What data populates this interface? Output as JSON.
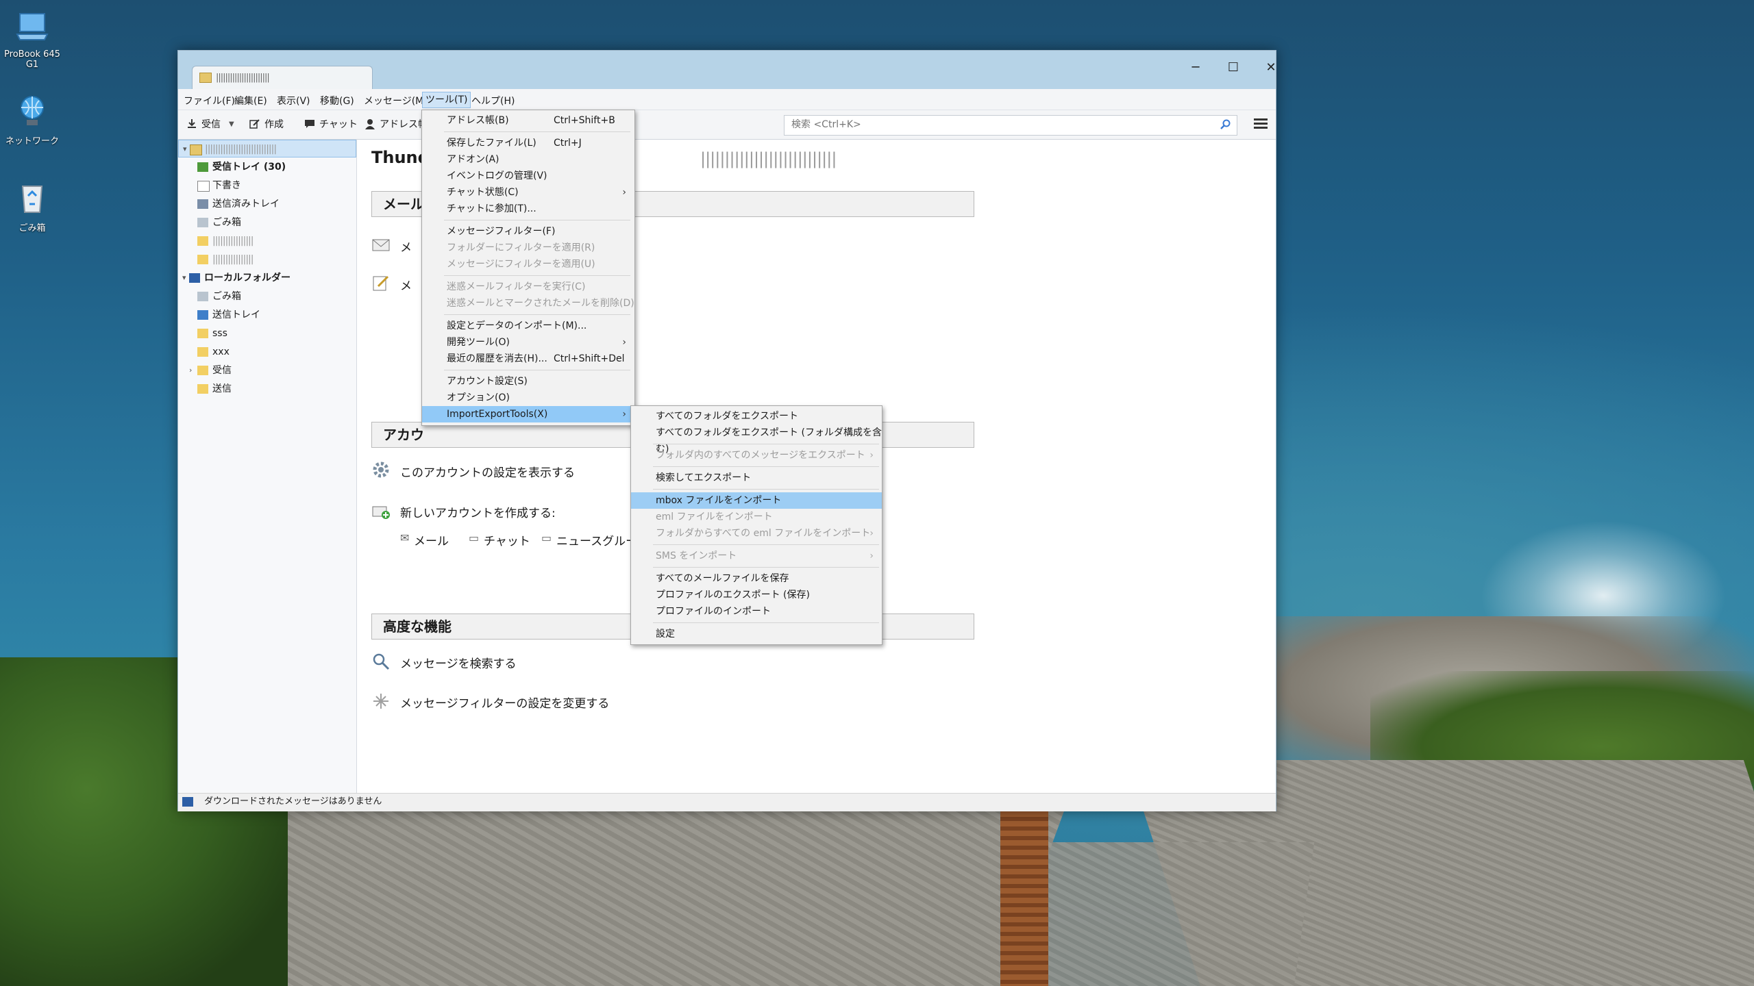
{
  "desktop": {
    "icons": [
      {
        "name": "probook-icon",
        "label": "ProBook 645 G1"
      },
      {
        "name": "network-icon",
        "label": "ネットワーク"
      },
      {
        "name": "recycle-bin-icon",
        "label": "ごみ箱"
      }
    ]
  },
  "window": {
    "tab_title": "|||||||||||||||||||||||",
    "controls": {
      "minimize": "─",
      "maximize": "☐",
      "close": "✕"
    }
  },
  "menubar": [
    "ファイル(F)",
    "編集(E)",
    "表示(V)",
    "移動(G)",
    "メッセージ(M)",
    "ツール(T)",
    "ヘルプ(H)"
  ],
  "toolbar": {
    "receive": "受信",
    "compose": "作成",
    "chat": "チャット",
    "address": "アドレス帳",
    "search_placeholder": "検索 <Ctrl+K>"
  },
  "folders": {
    "account": "||||||||||||||||||||||||||||",
    "inbox": "受信トレイ (30)",
    "drafts": "下書き",
    "sent": "送信済みトレイ",
    "trash": "ごみ箱",
    "blur1": "||||||||||||||||",
    "blur2": "||||||||||||||||",
    "local": "ローカルフォルダー",
    "local_trash": "ごみ箱",
    "outbox": "送信トレイ",
    "sss": "sss",
    "xxx": "xxx",
    "juushin": "受信",
    "soushin": "送信"
  },
  "content": {
    "title": "Thund",
    "title_blur": "||||||||||||||||||||||||||||",
    "mail_header": "メール",
    "item1": "メ",
    "item2": "メ",
    "account_header": "アカウ",
    "account_item": "このアカウントの設定を表示する",
    "new_account": "新しいアカウントを作成する:",
    "new_mail": "メール",
    "new_chat": "チャット",
    "new_news": "ニュースグルー",
    "advanced_header": "高度な機能",
    "search_messages": "メッセージを検索する",
    "filter_settings": "メッセージフィルターの設定を変更する"
  },
  "status": "ダウンロードされたメッセージはありません",
  "tools_menu": [
    {
      "label": "アドレス帳(B)",
      "shortcut": "Ctrl+Shift+B"
    },
    {
      "sep": true
    },
    {
      "label": "保存したファイル(L)",
      "shortcut": "Ctrl+J"
    },
    {
      "label": "アドオン(A)"
    },
    {
      "label": "イベントログの管理(V)"
    },
    {
      "label": "チャット状態(C)",
      "submenu": true
    },
    {
      "label": "チャットに参加(T)..."
    },
    {
      "sep": true
    },
    {
      "label": "メッセージフィルター(F)"
    },
    {
      "label": "フォルダーにフィルターを適用(R)",
      "disabled": true
    },
    {
      "label": "メッセージにフィルターを適用(U)",
      "disabled": true
    },
    {
      "sep": true
    },
    {
      "label": "迷惑メールフィルターを実行(C)",
      "disabled": true
    },
    {
      "label": "迷惑メールとマークされたメールを削除(D)",
      "disabled": true
    },
    {
      "sep": true
    },
    {
      "label": "設定とデータのインポート(M)..."
    },
    {
      "label": "開発ツール(O)",
      "submenu": true
    },
    {
      "label": "最近の履歴を消去(H)...",
      "shortcut": "Ctrl+Shift+Del"
    },
    {
      "sep": true
    },
    {
      "label": "アカウント設定(S)"
    },
    {
      "label": "オプション(O)"
    },
    {
      "label": "ImportExportTools(X)",
      "submenu": true,
      "highlight": true
    }
  ],
  "iet_menu": [
    {
      "label": "すべてのフォルダをエクスポート"
    },
    {
      "label": "すべてのフォルダをエクスポート (フォルダ構成を含む)"
    },
    {
      "sep": true
    },
    {
      "label": "フォルダ内のすべてのメッセージをエクスポート",
      "submenu": true,
      "disabled": true
    },
    {
      "sep": true
    },
    {
      "label": "検索してエクスポート"
    },
    {
      "sep": true
    },
    {
      "label": "mbox ファイルをインポート",
      "highlight": true
    },
    {
      "label": "eml ファイルをインポート",
      "disabled": true
    },
    {
      "label": "フォルダからすべての eml ファイルをインポート",
      "submenu": true,
      "disabled": true
    },
    {
      "sep": true
    },
    {
      "label": "SMS をインポート",
      "submenu": true,
      "disabled": true
    },
    {
      "sep": true
    },
    {
      "label": "すべてのメールファイルを保存"
    },
    {
      "label": "プロファイルのエクスポート (保存)"
    },
    {
      "label": "プロファイルのインポート"
    },
    {
      "sep": true
    },
    {
      "label": "設定"
    }
  ]
}
